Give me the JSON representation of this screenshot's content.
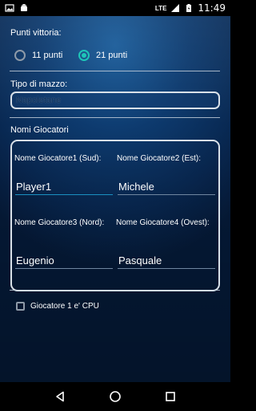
{
  "status_bar": {
    "network": "LTE",
    "time": "11:49"
  },
  "victory": {
    "label": "Punti vittoria:",
    "options": [
      {
        "label": "11 punti",
        "checked": false
      },
      {
        "label": "21 punti",
        "checked": true
      }
    ]
  },
  "deck": {
    "label": "Tipo di mazzo:",
    "value": "Napoletane"
  },
  "players": {
    "label": "Nomi Giocatori",
    "items": [
      {
        "label": "Nome Giocatore1 (Sud):",
        "value": "Player1"
      },
      {
        "label": "Nome Giocatore2 (Est):",
        "value": "Michele"
      },
      {
        "label": "Nome Giocatore3 (Nord):",
        "value": "Eugenio"
      },
      {
        "label": "Nome Giocatore4 (Ovest):",
        "value": "Pasquale"
      }
    ]
  },
  "cpu_checkbox": {
    "label": "Giocatore 1 e' CPU",
    "checked": false
  },
  "icons": {
    "status_left": [
      "image-icon",
      "android-icon"
    ],
    "status_right": [
      "signal-icon",
      "battery-icon"
    ],
    "nav": [
      "back-icon",
      "home-icon",
      "recents-icon"
    ]
  },
  "colors": {
    "accent": "#1ec6b8",
    "background": "#0d3a6e"
  }
}
